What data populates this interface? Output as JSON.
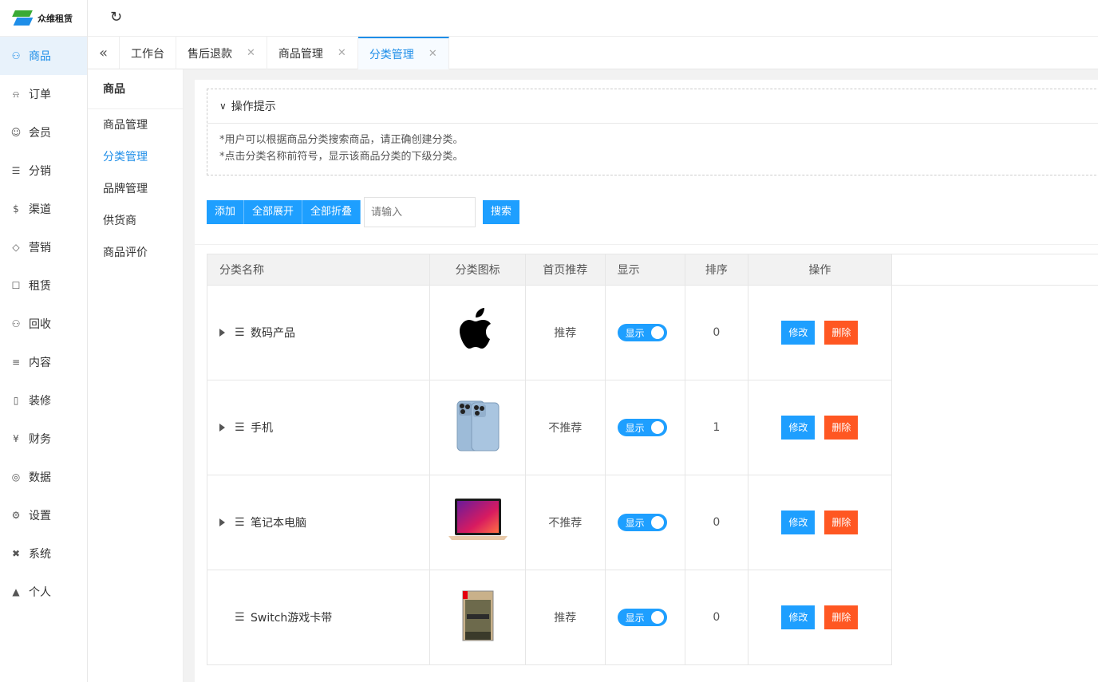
{
  "brand": {
    "name": "众维租赁"
  },
  "rail": [
    {
      "label": "商品",
      "icon": "cart-icon",
      "active": true
    },
    {
      "label": "订单",
      "icon": "bell-icon"
    },
    {
      "label": "会员",
      "icon": "user-icon"
    },
    {
      "label": "分销",
      "icon": "layers-icon"
    },
    {
      "label": "渠道",
      "icon": "dollar-icon"
    },
    {
      "label": "营销",
      "icon": "diamond-icon"
    },
    {
      "label": "租赁",
      "icon": "shield-icon"
    },
    {
      "label": "回收",
      "icon": "cart-icon"
    },
    {
      "label": "内容",
      "icon": "book-icon"
    },
    {
      "label": "装修",
      "icon": "tablet-icon"
    },
    {
      "label": "财务",
      "icon": "yen-icon"
    },
    {
      "label": "数据",
      "icon": "globe-icon"
    },
    {
      "label": "设置",
      "icon": "gear-icon"
    },
    {
      "label": "系统",
      "icon": "tools-icon"
    },
    {
      "label": "个人",
      "icon": "person-icon"
    }
  ],
  "tabs": [
    {
      "label": "工作台",
      "closable": false
    },
    {
      "label": "售后退款",
      "closable": true
    },
    {
      "label": "商品管理",
      "closable": true
    },
    {
      "label": "分类管理",
      "closable": true,
      "active": true
    }
  ],
  "subnav": {
    "title": "商品",
    "items": [
      "商品管理",
      "分类管理",
      "品牌管理",
      "供货商",
      "商品评价"
    ],
    "active_index": 1
  },
  "tips": {
    "title": "操作提示",
    "lines": [
      "*用户可以根据商品分类搜索商品，请正确创建分类。",
      "*点击分类名称前符号，显示该商品分类的下级分类。"
    ]
  },
  "toolbar": {
    "add": "添加",
    "expand_all": "全部展开",
    "collapse_all": "全部折叠",
    "search_placeholder": "请输入",
    "search": "搜索"
  },
  "table": {
    "headers": {
      "name": "分类名称",
      "icon": "分类图标",
      "recommend": "首页推荐",
      "show": "显示",
      "sort": "排序",
      "ops": "操作"
    },
    "rows": [
      {
        "name": "数码产品",
        "has_children": true,
        "icon": "apple-logo-icon",
        "recommend": "推荐",
        "show": "显示",
        "sort": "0",
        "edit": "修改",
        "del": "删除"
      },
      {
        "name": "手机",
        "has_children": true,
        "icon": "iphone-icon",
        "recommend": "不推荐",
        "show": "显示",
        "sort": "1",
        "edit": "修改",
        "del": "删除"
      },
      {
        "name": "笔记本电脑",
        "has_children": true,
        "icon": "laptop-icon",
        "recommend": "不推荐",
        "show": "显示",
        "sort": "0",
        "edit": "修改",
        "del": "删除"
      },
      {
        "name": "Switch游戏卡带",
        "has_children": false,
        "icon": "game-cartridge-icon",
        "recommend": "推荐",
        "show": "显示",
        "sort": "0",
        "edit": "修改",
        "del": "删除"
      }
    ]
  },
  "colors": {
    "accent": "#1e9fff",
    "danger": "#ff5722",
    "active_nav_bg": "#e8f2fb"
  }
}
